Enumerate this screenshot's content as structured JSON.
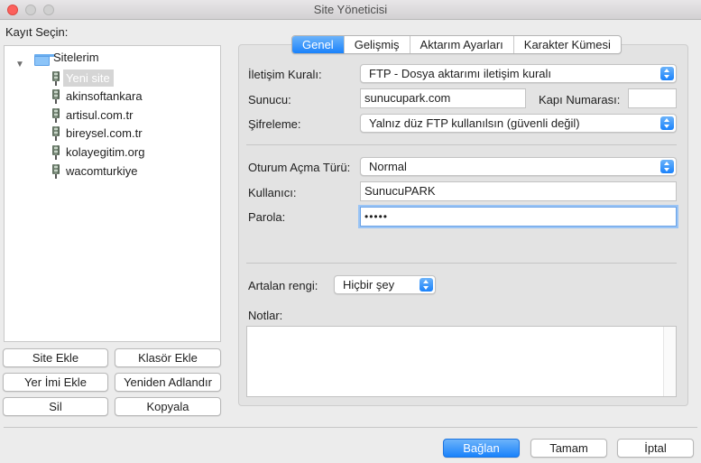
{
  "window": {
    "title": "Site Yöneticisi"
  },
  "left": {
    "select_label": "Kayıt Seçin:",
    "root_folder": "Sitelerim",
    "sites": [
      "Yeni site",
      "akinsoftankara",
      "artisul.com.tr",
      "bireysel.com.tr",
      "kolayegitim.org",
      "wacomturkiye"
    ],
    "selected_site": "Yeni site",
    "buttons": {
      "site_add": "Site Ekle",
      "folder_add": "Klasör Ekle",
      "bookmark_add": "Yer İmi Ekle",
      "rename": "Yeniden Adlandır",
      "delete": "Sil",
      "copy": "Kopyala"
    }
  },
  "tabs": [
    "Genel",
    "Gelişmiş",
    "Aktarım Ayarları",
    "Karakter Kümesi"
  ],
  "active_tab": "Genel",
  "form": {
    "protocol_label": "İletişim Kuralı:",
    "protocol_value": "FTP - Dosya aktarımı iletişim kuralı",
    "host_label": "Sunucu:",
    "host_value": "sunucupark.com",
    "port_label": "Kapı Numarası:",
    "port_value": "",
    "encryption_label": "Şifreleme:",
    "encryption_value": "Yalnız düz FTP kullanılsın (güvenli değil)",
    "logon_label": "Oturum Açma Türü:",
    "logon_value": "Normal",
    "user_label": "Kullanıcı:",
    "user_value": "SunucuPARK",
    "password_label": "Parola:",
    "password_value": "•••••",
    "bg_color_label": "Artalan rengi:",
    "bg_color_value": "Hiçbir şey",
    "notes_label": "Notlar:",
    "notes_value": ""
  },
  "footer": {
    "connect": "Bağlan",
    "ok": "Tamam",
    "cancel": "İptal"
  },
  "colors": {
    "accent": "#1a82fb",
    "selection": "#d5d5d5"
  }
}
